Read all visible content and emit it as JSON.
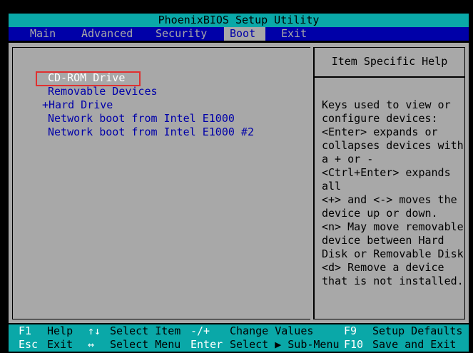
{
  "title": "PhoenixBIOS Setup Utility",
  "menu": {
    "items": [
      {
        "label": "Main"
      },
      {
        "label": "Advanced"
      },
      {
        "label": "Security"
      },
      {
        "label": "Boot"
      },
      {
        "label": "Exit"
      }
    ],
    "active": "Boot"
  },
  "boot_list": {
    "items": [
      {
        "label": "CD-ROM Drive"
      },
      {
        "label": "Removable Devices"
      },
      {
        "label": "+Hard Drive"
      },
      {
        "label": "Network boot from Intel E1000"
      },
      {
        "label": "Network boot from Intel E1000 #2"
      }
    ],
    "selected": "CD-ROM Drive"
  },
  "help": {
    "title": "Item Specific Help",
    "lines": [
      "Keys used to view or",
      "configure devices:",
      "<Enter> expands or",
      "collapses devices with",
      "a + or -",
      "<Ctrl+Enter> expands",
      "all",
      "<+> and <-> moves the",
      "device up or down.",
      "<n> May move removable",
      "device between Hard",
      "Disk or Removable Disk",
      "<d> Remove a device",
      "that is not installed."
    ]
  },
  "footer": {
    "row1": [
      {
        "key": "F1",
        "desc": "Help"
      },
      {
        "key": "↑↓",
        "desc": "Select Item"
      },
      {
        "key": "-/+",
        "desc": "Change Values"
      },
      {
        "key": "F9",
        "desc": "Setup Defaults"
      }
    ],
    "row2": [
      {
        "key": "Esc",
        "desc": "Exit"
      },
      {
        "key": "↔",
        "desc": "Select Menu"
      },
      {
        "key": "Enter",
        "desc": "Select ▶ Sub-Menu"
      },
      {
        "key": "F10",
        "desc": "Save and Exit"
      }
    ]
  },
  "colors": {
    "menu_bar": "#0000a8",
    "title_bar": "#0aa8a8",
    "panel": "#a8a8a8",
    "item_text": "#0000a8",
    "selected_text": "#ffffff",
    "selection_outline": "#e03030"
  }
}
